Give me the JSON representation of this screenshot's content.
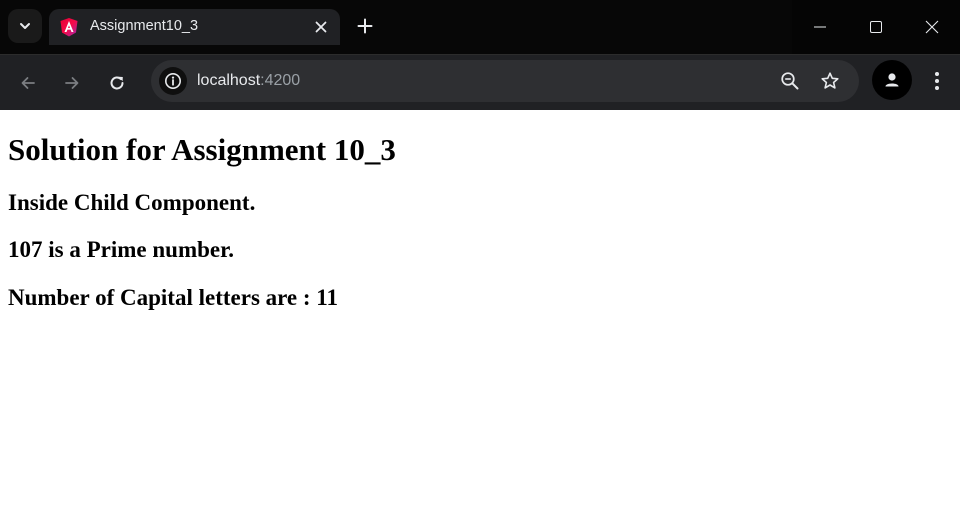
{
  "browser": {
    "tab": {
      "title": "Assignment10_3",
      "favicon": "angular-icon"
    },
    "address_bar": {
      "host": "localhost",
      "port": ":4200"
    },
    "colors": {
      "tabstrip_bg": "#070707",
      "toolbar_bg": "#202124",
      "omnibox_bg": "#2e2f32",
      "angular_red": "#dd0031",
      "angular_magenta": "#c3002f"
    }
  },
  "page": {
    "heading": "Solution for Assignment 10_3",
    "lines": [
      "Inside Child Component.",
      "107 is a Prime number.",
      "Number of Capital letters are : 11"
    ]
  }
}
